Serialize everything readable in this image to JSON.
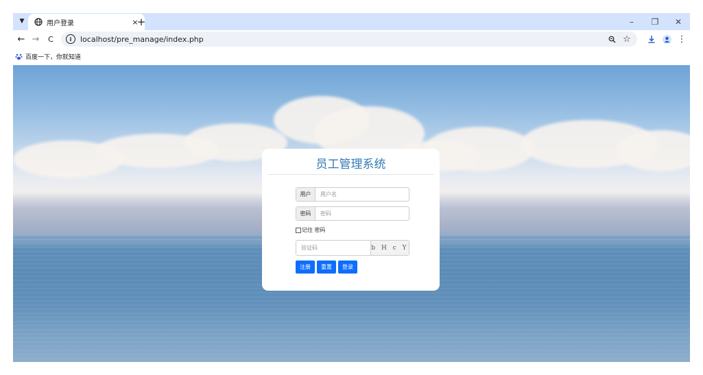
{
  "tab": {
    "title": "用户登录",
    "close": "×",
    "new_tab": "+"
  },
  "window_controls": {
    "minimize": "–",
    "restore": "❐",
    "close": "✕"
  },
  "toolbar": {
    "back": "←",
    "forward": "→",
    "reload": "C",
    "url": "localhost/pre_manage/index.php",
    "zoom_icon": "zoom-icon",
    "star_icon": "bookmark-star-icon",
    "download_icon": "download-icon",
    "profile_icon": "profile-icon",
    "menu_icon": "more-menu-icon"
  },
  "bookmarks": [
    {
      "label": "百度一下，你就知道",
      "icon": "baidu-paw-icon"
    }
  ],
  "login": {
    "title": "员工管理系统",
    "username_label": "用户",
    "username_placeholder": "用户名",
    "password_label": "密码",
    "password_placeholder": "密码",
    "remember_label": "记住 密码",
    "remember_checked": false,
    "captcha_placeholder": "验证码",
    "captcha_text": "b H c Y",
    "buttons": {
      "register": "注册",
      "reset": "重置",
      "login": "登录"
    }
  },
  "colors": {
    "tab_strip": "#d3e3fd",
    "title": "#337ab7",
    "button": "#0d6efd"
  }
}
